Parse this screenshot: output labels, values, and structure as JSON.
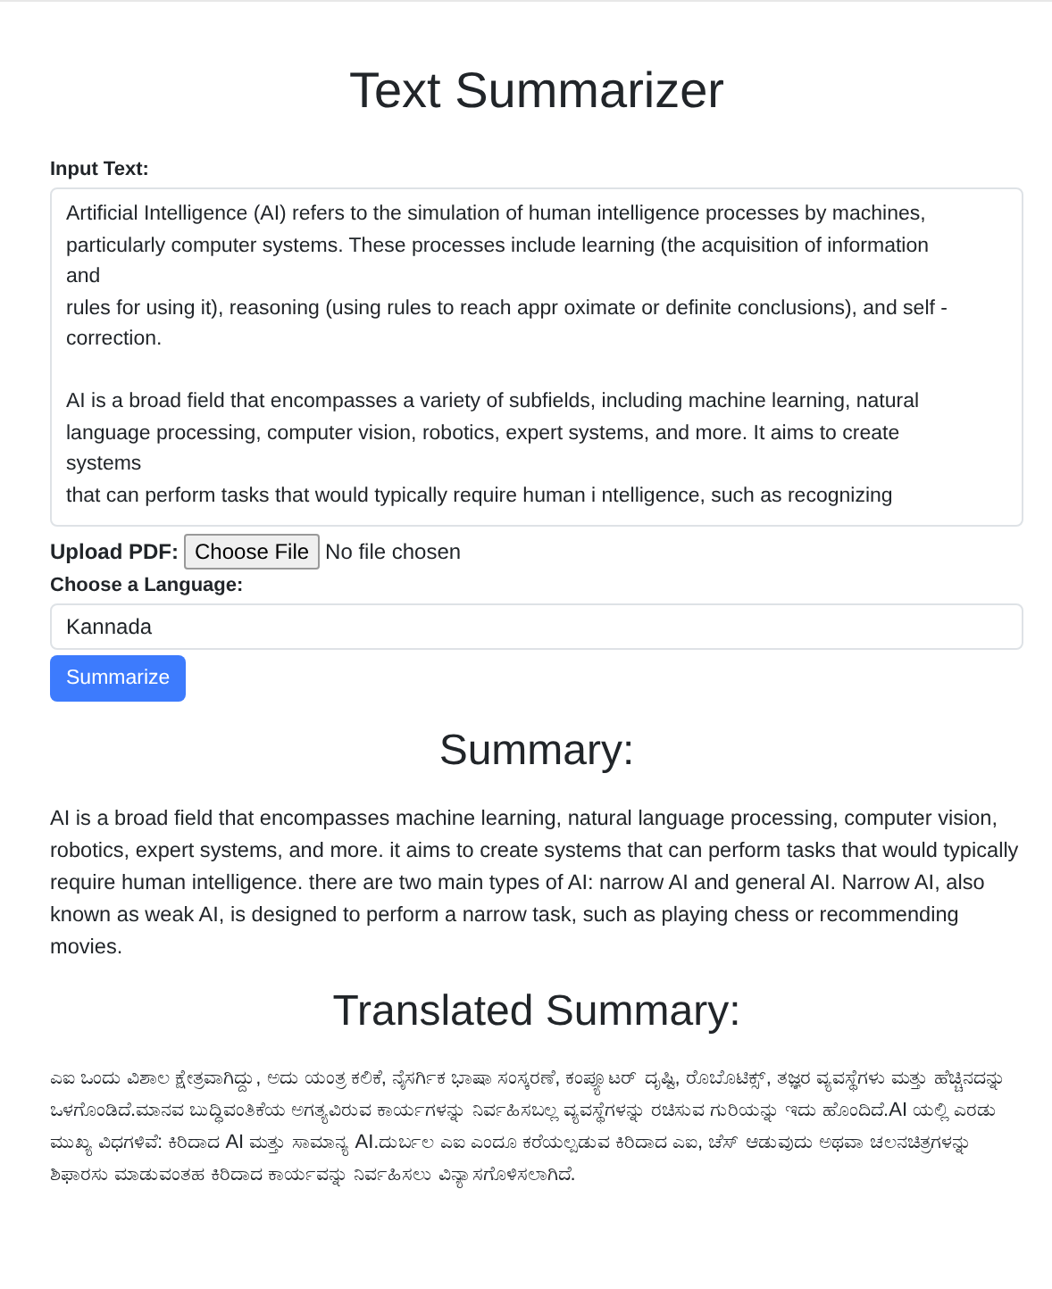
{
  "title": "Text Summarizer",
  "input_text": {
    "label": "Input Text:",
    "value": "Artificial Intelligence (AI) refers to the simulation of human intelligence processes by machines, particularly computer systems. These processes include learning (the acquisition of information\nand\nrules for using it), reasoning (using rules to reach appr oximate or definite conclusions), and self - correction.\n\nAI is a broad field that encompasses a variety of subfields, including machine learning, natural language processing, computer vision, robotics, expert systems, and more. It aims to create\nsystems\nthat can perform tasks that would typically require human i ntelligence, such as recognizing"
  },
  "upload": {
    "label": "Upload PDF:",
    "button": "Choose File",
    "status": "No file chosen"
  },
  "language": {
    "label": "Choose a Language:",
    "value": "Kannada"
  },
  "submit": "Summarize",
  "summary": {
    "heading": "Summary:",
    "text": "AI is a broad field that encompasses machine learning, natural language processing, computer vision, robotics, expert systems, and more. it aims to create systems that can perform tasks that would typically require human intelligence. there are two main types of AI: narrow AI and general AI. Narrow AI, also known as weak AI, is designed to perform a narrow task, such as playing chess or recommending movies."
  },
  "translated": {
    "heading": "Translated Summary:",
    "text": "ಎಐ ಒಂದು ವಿಶಾಲ ಕ್ಷೇತ್ರವಾಗಿದ್ದು, ಅದು ಯಂತ್ರ ಕಲಿಕೆ, ನೈಸರ್ಗಿಕ ಭಾಷಾ ಸಂಸ್ಕರಣೆ, ಕಂಪ್ಯೂಟರ್ ದೃಷ್ಟಿ, ರೊಬೊಟಿಕ್ಸ್, ತಜ್ಞರ ವ್ಯವಸ್ಥೆಗಳು ಮತ್ತು ಹೆಚ್ಚಿನದನ್ನು ಒಳಗೊಂಡಿದೆ.ಮಾನವ ಬುದ್ಧಿವಂತಿಕೆಯ ಅಗತ್ಯವಿರುವ ಕಾರ್ಯಗಳನ್ನು ನಿರ್ವಹಿಸಬಲ್ಲ ವ್ಯವಸ್ಥೆಗಳನ್ನು ರಚಿಸುವ ಗುರಿಯನ್ನು ಇದು ಹೊಂದಿದೆ.AI ಯಲ್ಲಿ ಎರಡು ಮುಖ್ಯ ವಿಧಗಳಿವೆ: ಕಿರಿದಾದ AI ಮತ್ತು ಸಾಮಾನ್ಯ AI.ದುರ್ಬಲ ಎಐ ಎಂದೂ ಕರೆಯಲ್ಪಡುವ ಕಿರಿದಾದ ಎಐ, ಚೆಸ್ ಆಡುವುದು ಅಥವಾ ಚಲನಚಿತ್ರಗಳನ್ನು ಶಿಫಾರಸು ಮಾಡುವಂತಹ ಕಿರಿದಾದ ಕಾರ್ಯವನ್ನು ನಿರ್ವಹಿಸಲು ವಿನ್ಯಾಸಗೊಳಿಸಲಾಗಿದೆ."
  }
}
